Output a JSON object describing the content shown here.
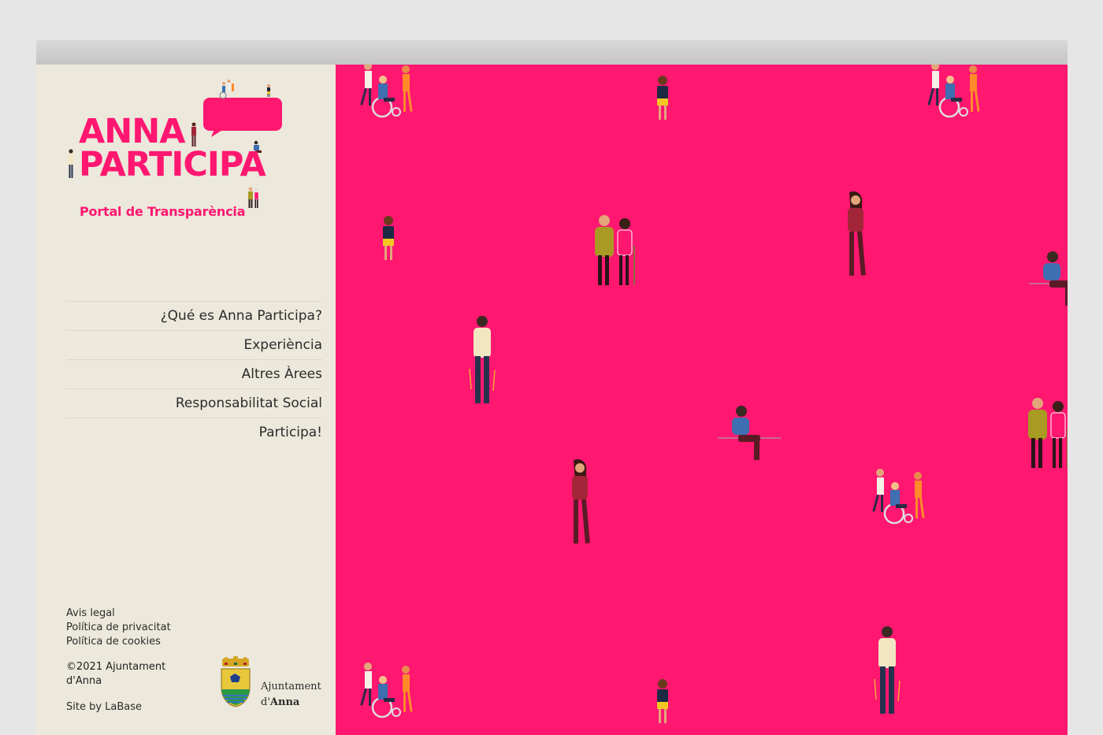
{
  "brand": {
    "title_line1": "ANNA",
    "title_line2": "PARTICIPA",
    "subtitle": "Portal de Transparència",
    "color": "#ff1770"
  },
  "nav": {
    "items": [
      {
        "label": "¿Qué es Anna Participa?"
      },
      {
        "label": "Experiència"
      },
      {
        "label": "Altres Àrees"
      },
      {
        "label": "Responsabilitat Social"
      },
      {
        "label": "Participa!"
      }
    ]
  },
  "footer": {
    "legal_links": [
      "Avis legal",
      "Política de privacitat",
      "Política de cookies"
    ],
    "copyright": "©2021 Ajuntament d'Anna",
    "site_by": "Site by LaBase",
    "municipality_line1": "Ajuntament",
    "municipality_line2_prefix": "d'",
    "municipality_line2_name": "Anna"
  },
  "theme": {
    "hero_background": "#ff1770",
    "sidebar_background": "#ece8dc"
  },
  "illustrations": [
    {
      "icon": "wheelchair-group-icon"
    },
    {
      "icon": "child-icon"
    },
    {
      "icon": "wheelchair-group-icon"
    },
    {
      "icon": "child-icon"
    },
    {
      "icon": "elderly-couple-icon"
    },
    {
      "icon": "woman-standing-icon"
    },
    {
      "icon": "man-sitting-icon"
    },
    {
      "icon": "man-standing-icon"
    },
    {
      "icon": "man-sitting-icon"
    },
    {
      "icon": "elderly-couple-icon"
    },
    {
      "icon": "woman-standing-icon"
    },
    {
      "icon": "wheelchair-group-icon"
    },
    {
      "icon": "wheelchair-group-icon"
    },
    {
      "icon": "child-icon"
    },
    {
      "icon": "man-standing-icon"
    }
  ]
}
